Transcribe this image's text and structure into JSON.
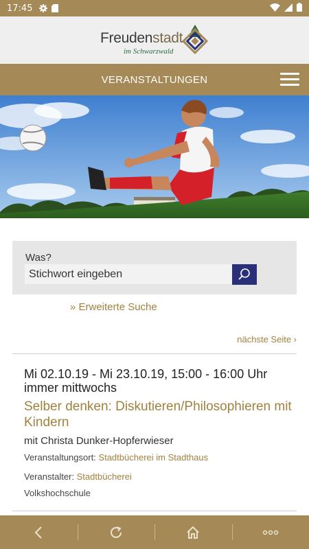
{
  "status_bar": {
    "time": "17:45",
    "icons": [
      "gear-icon",
      "sd-card-icon",
      "wifi-icon",
      "cell-signal-icon",
      "battery-icon"
    ]
  },
  "logo": {
    "brand_part1": "Freuden",
    "brand_part2": "stadt",
    "tagline": "im Schwarzwald"
  },
  "header": {
    "title": "VERANSTALTUNGEN",
    "menu_icon": "hamburger-menu-icon"
  },
  "search": {
    "label": "Was?",
    "placeholder": "Stichwort eingeben",
    "button_icon": "search-icon",
    "advanced_link": "» Erweiterte Suche"
  },
  "pagination": {
    "next_label": "nächste Seite ›"
  },
  "event": {
    "date": "Mi 02.10.19 - Mi 23.10.19, 15:00 - 16:00 Uhr immer mittwochs",
    "title": "Selber denken: Diskutieren/Philosophieren mit Kindern",
    "speaker": "mit Christa Dunker-Hopferwieser",
    "venue_label": "Veranstaltungsort:",
    "venue_value": "Stadtbücherei im Stadthaus",
    "organizer_label": "Veranstalter:",
    "organizer_value": "Stadtbücherei",
    "organizer_extra": "Volkshochschule"
  },
  "bottom_nav": [
    {
      "name": "back-icon"
    },
    {
      "name": "reload-icon"
    },
    {
      "name": "home-icon"
    },
    {
      "name": "more-icon"
    }
  ],
  "colors": {
    "brand_gold": "#a58a58",
    "link_gold": "#a0823e",
    "search_button": "#2a2f7a",
    "panel_grey": "#e6e6e6"
  }
}
